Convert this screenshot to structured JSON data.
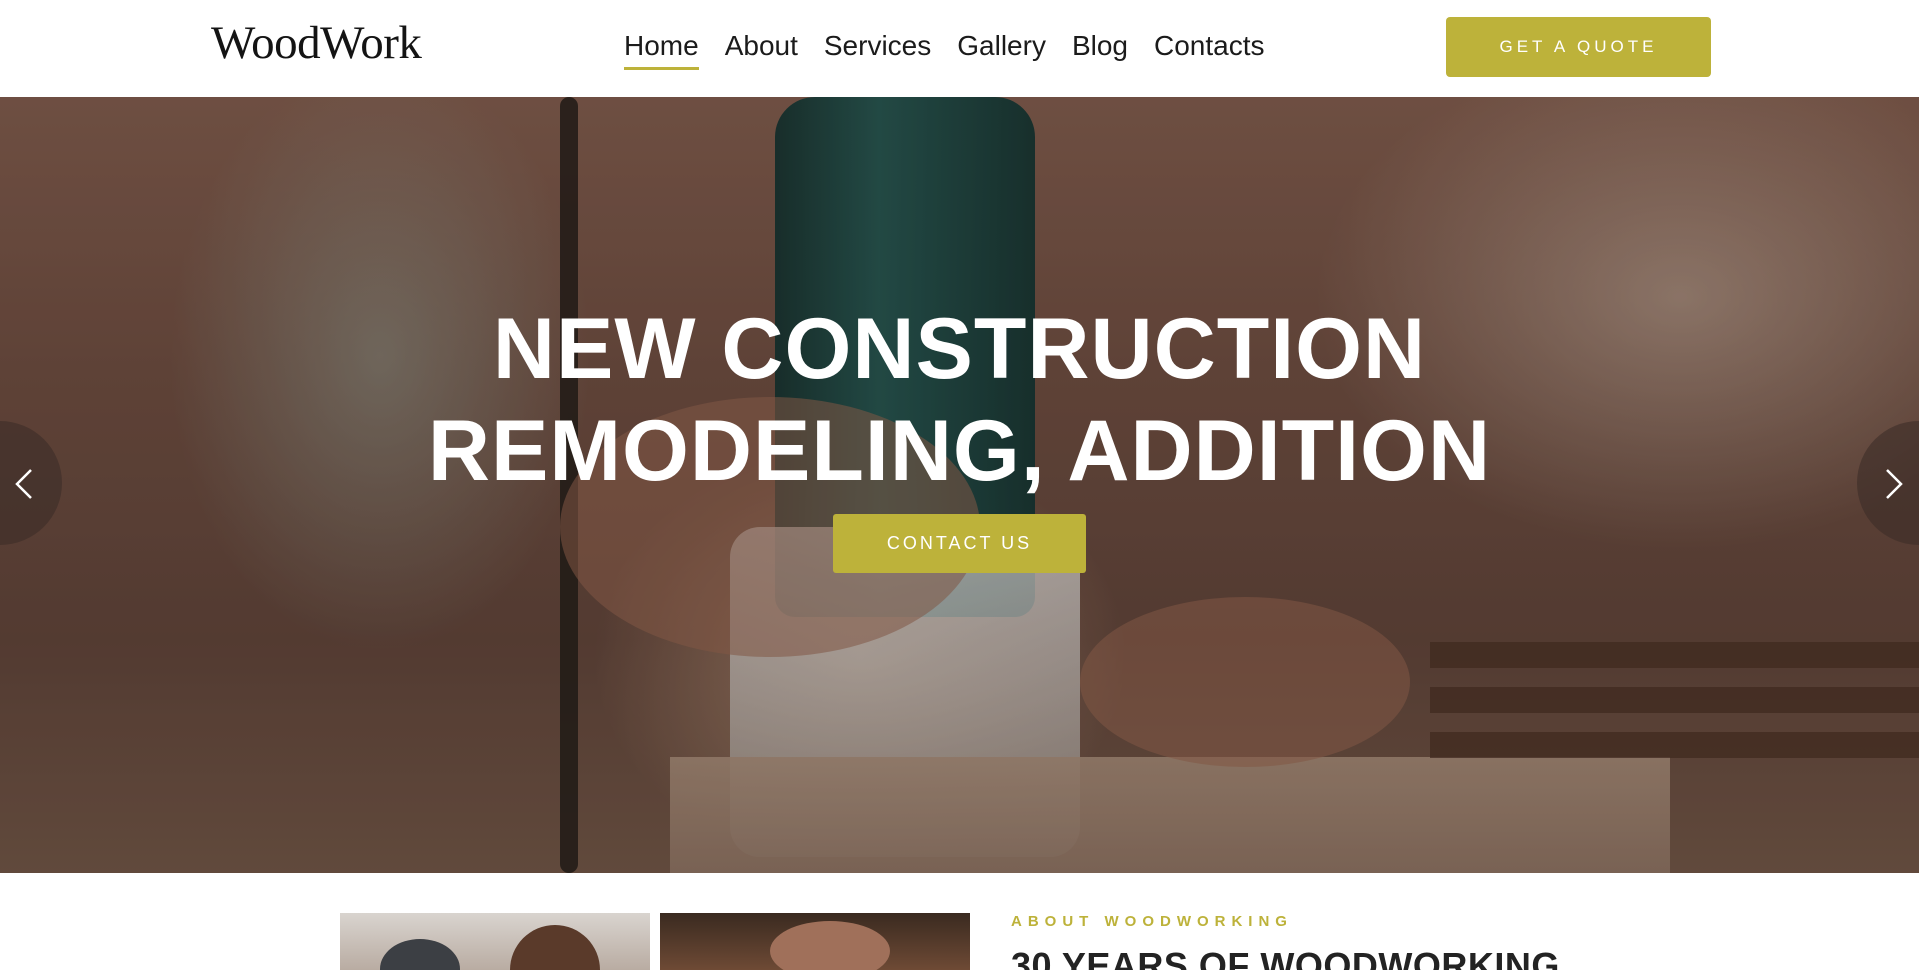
{
  "header": {
    "logo": "WoodWork",
    "nav": [
      {
        "label": "Home",
        "active": true
      },
      {
        "label": "About",
        "active": false
      },
      {
        "label": "Services",
        "active": false
      },
      {
        "label": "Gallery",
        "active": false
      },
      {
        "label": "Blog",
        "active": false
      },
      {
        "label": "Contacts",
        "active": false
      }
    ],
    "cta_label": "GET A QUOTE"
  },
  "hero": {
    "title_line1": "NEW CONSTRUCTION",
    "title_line2": "REMODELING, ADDITION",
    "button_label": "CONTACT US",
    "prev_icon": "chevron-left-icon",
    "next_icon": "chevron-right-icon"
  },
  "about": {
    "kicker": "ABOUT WOODWORKING",
    "title": "30 YEARS OF WOODWORKING"
  },
  "colors": {
    "accent": "#bdb23a",
    "text": "#1b1b1b",
    "hero_text": "#ffffff"
  }
}
